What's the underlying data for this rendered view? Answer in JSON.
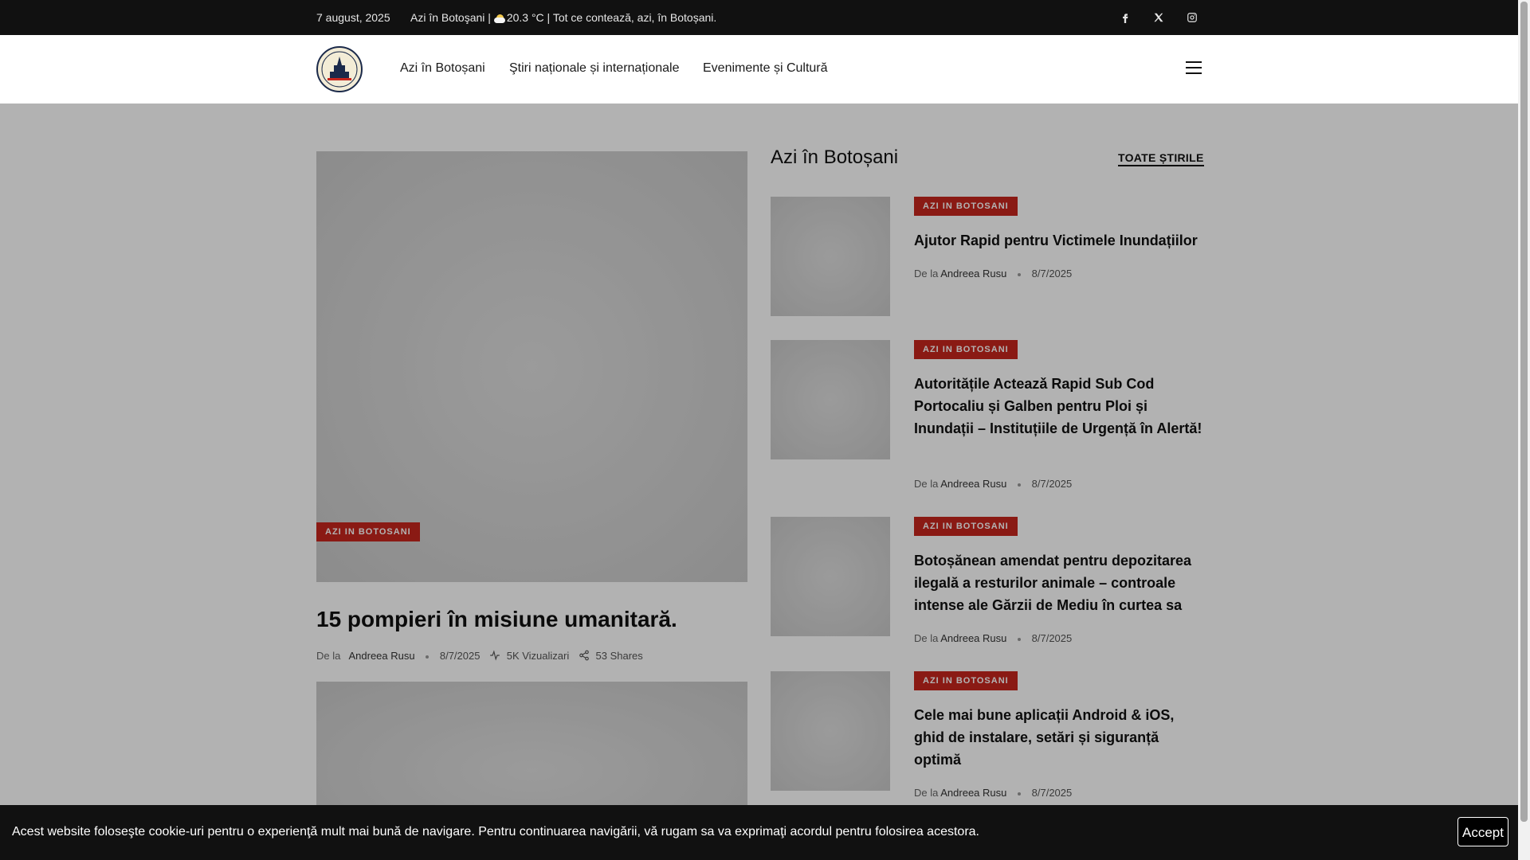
{
  "topbar": {
    "date": "7 august, 2025",
    "tagline_prefix": "Azi în Botoşani | ",
    "tagline_suffix": "20.3 °C | Tot ce contează, azi, în Botoșani.",
    "weather_icon": "partly-cloudy-icon",
    "social": [
      "facebook-icon",
      "x-icon",
      "instagram-icon"
    ]
  },
  "header": {
    "logo": "azi-in-botosani-logo",
    "nav": [
      "Azi în Botoșani",
      "Ştiri naționale și internaționale",
      "Evenimente și Cultură"
    ],
    "menu_icon": "hamburger-icon"
  },
  "hero": {
    "category": "AZI IN BOTOSANI",
    "title": "15 pompieri în misiune umanitară.",
    "by": "De la",
    "author": "Andreea Rusu",
    "date": "8/7/2025",
    "views": "5K Vizualizari",
    "shares": "53 Shares"
  },
  "sidebar": {
    "title": "Azi în Botoșani",
    "all_link": "TOATE ȘTIRILE",
    "articles": [
      {
        "category": "AZI IN BOTOSANI",
        "title": "Ajutor Rapid pentru Victimele Inundațiilor",
        "by": "De la",
        "author": "Andreea Rusu",
        "date": "8/7/2025"
      },
      {
        "category": "AZI IN BOTOSANI",
        "title": "Autoritățile Acteazǎ Rapid Sub Cod Portocaliu și Galben pentru Ploi și Inundații – Instituțiile de Urgență în Alertă!",
        "by": "De la",
        "author": "Andreea Rusu",
        "date": "8/7/2025"
      },
      {
        "category": "AZI IN BOTOSANI",
        "title": "Botoșănean amendat pentru depozitarea ilegală a resturilor animale – controale intense ale Gărzii de Mediu în curtea sa",
        "by": "De la",
        "author": "Andreea Rusu",
        "date": "8/7/2025"
      },
      {
        "category": "AZI IN BOTOSANI",
        "title": "Cele mai bune aplicații Android & iOS, ghid de instalare, setări și siguranță optimă",
        "by": "De la",
        "author": "Andreea Rusu",
        "date": "8/7/2025"
      }
    ]
  },
  "cookie": {
    "message": "Acest website foloseşte cookie-uri pentru o experienţă mult mai bună de navigare. Pentru continuarea navigării, vă rugam sa va exprimaţi acordul pentru folosirea acestora.",
    "accept": "Accept"
  },
  "colors": {
    "badge": "#c6261d",
    "bar": "#111111"
  }
}
